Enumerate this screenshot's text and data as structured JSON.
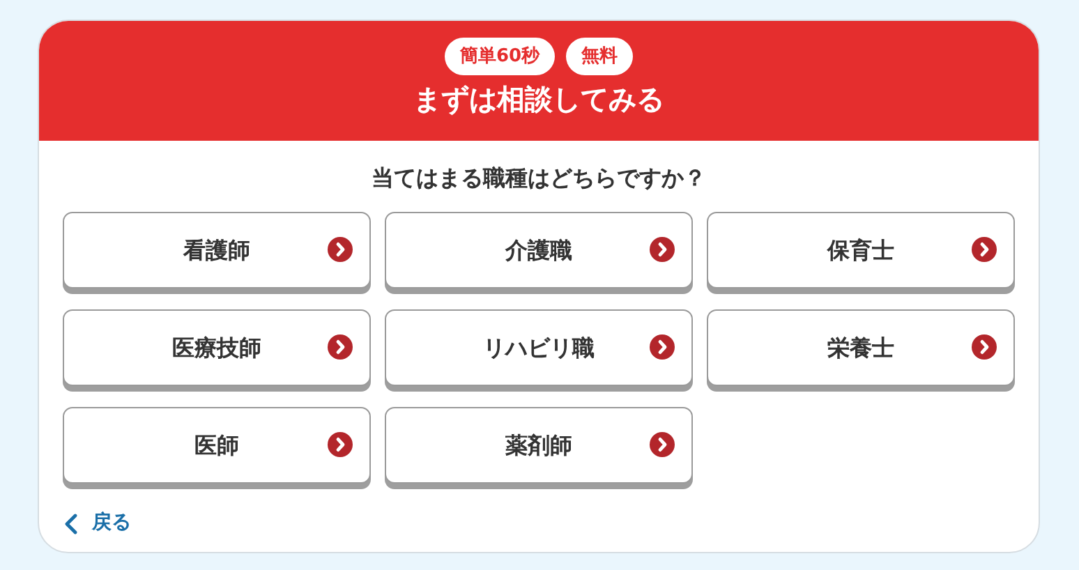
{
  "header": {
    "badges": [
      "簡単60秒",
      "無料"
    ],
    "title": "まずは相談してみる"
  },
  "question": "当てはまる職種はどちらですか？",
  "options": [
    {
      "label": "看護師"
    },
    {
      "label": "介護職"
    },
    {
      "label": "保育士"
    },
    {
      "label": "医療技師"
    },
    {
      "label": "リハビリ職"
    },
    {
      "label": "栄養士"
    },
    {
      "label": "医師"
    },
    {
      "label": "薬剤師"
    }
  ],
  "back": {
    "label": "戻る"
  }
}
